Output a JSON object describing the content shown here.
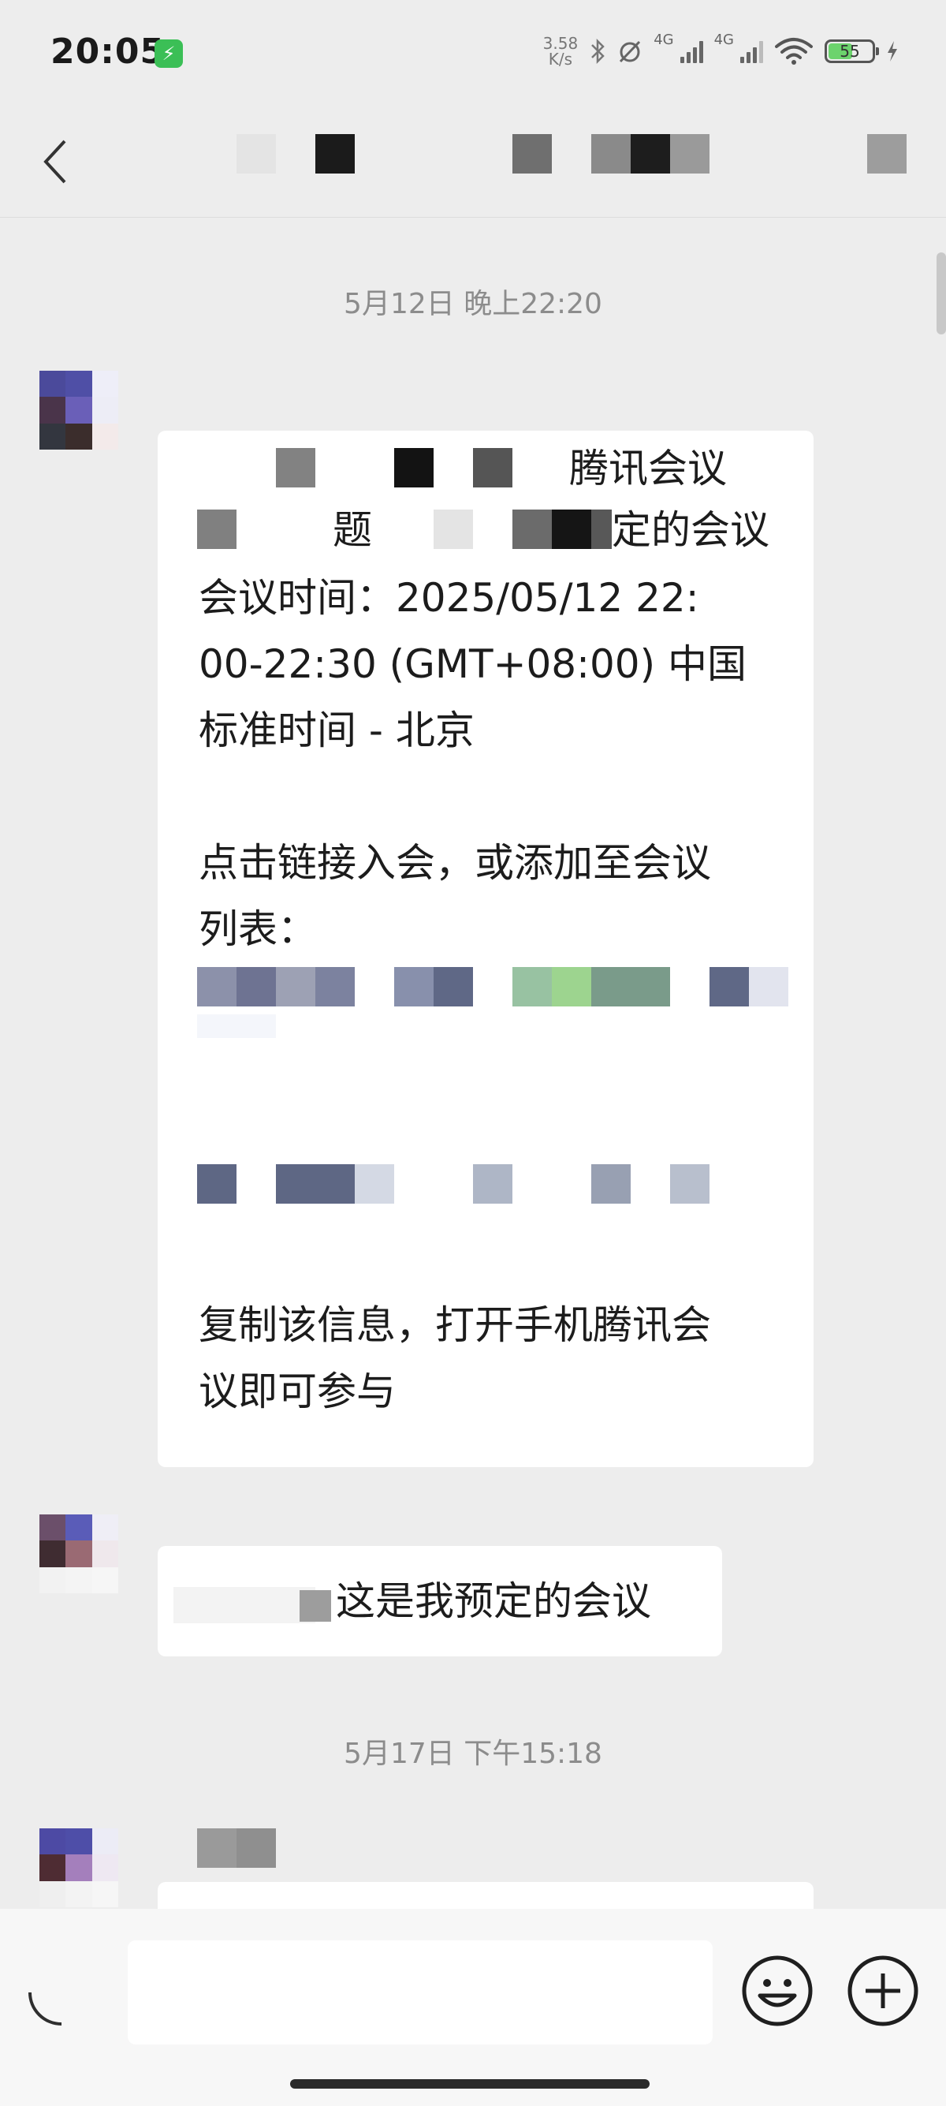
{
  "status_bar": {
    "time": "20:05",
    "net_speed_value": "3.58",
    "net_speed_unit": "K/s",
    "signal_1_label": "4G",
    "signal_2_label": "4G",
    "battery_level": "55",
    "battery_fraction": 0.55
  },
  "header": {
    "back_icon": "chevron-left-icon"
  },
  "chat": {
    "timestamp_1": "5月12日 晚上22:20",
    "timestamp_2": "5月17日 下午15:18",
    "message_1": {
      "line_1": "腾讯会议",
      "line_2_a": "题",
      "line_2_b": "定的会议",
      "line_3": "会议时间：2025/05/12 22:",
      "line_4": "00-22:30 (GMT+08:00) 中国",
      "line_5": "标准时间 - 北京",
      "line_6": "点击链接入会，或添加至会议",
      "line_7": "列表：",
      "line_8": "复制该信息，打开手机腾讯会",
      "line_9": "议即可参与"
    },
    "message_2": {
      "text": "这是我预定的会议"
    }
  },
  "input_bar": {
    "voice_icon": "voice-icon",
    "emoji_icon": "emoji-icon",
    "add_icon": "plus-circle-icon",
    "placeholder": ""
  },
  "colors": {
    "background": "#ededed",
    "bubble": "#ffffff",
    "timestamp": "#8c8c8c",
    "charge_badge": "#3bbf56"
  }
}
